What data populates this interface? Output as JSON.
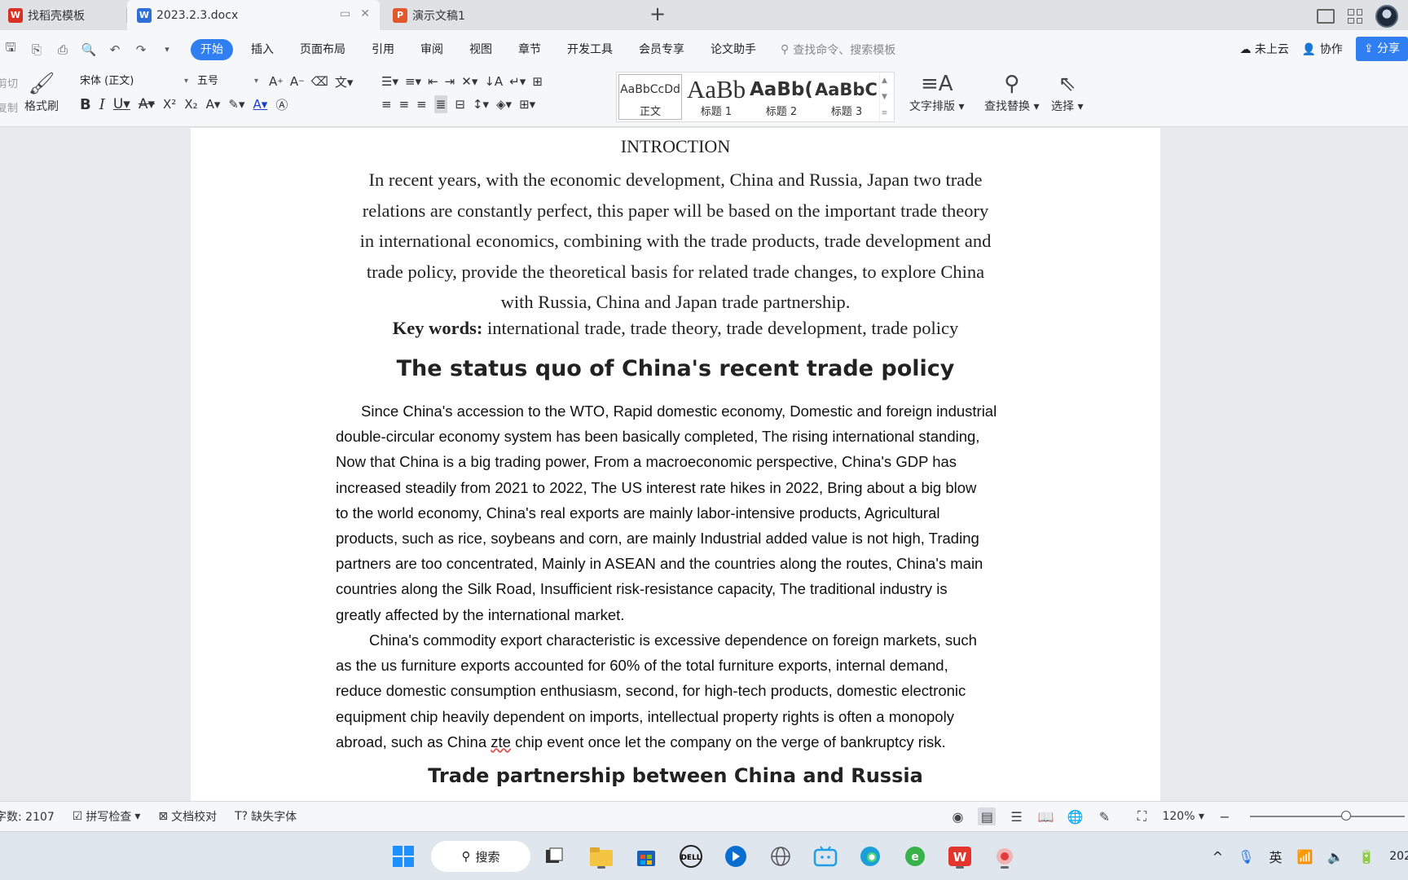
{
  "tabs": [
    {
      "label": "找稻壳模板",
      "icon": "wps-red-icon",
      "color": "#d93025"
    },
    {
      "label": "2023.2.3.docx",
      "icon": "wps-writer-icon",
      "color": "#2f6fd6"
    },
    {
      "label": "演示文稿1",
      "icon": "wps-presentation-icon",
      "color": "#e2572b"
    }
  ],
  "menu": {
    "items": [
      "开始",
      "插入",
      "页面布局",
      "引用",
      "审阅",
      "视图",
      "章节",
      "开发工具",
      "会员专享",
      "论文助手"
    ],
    "search_placeholder": "查找命令、搜索模板",
    "not_synced": "未上云",
    "collaborate": "协作",
    "share": "分享"
  },
  "ribbon": {
    "cut": "剪切",
    "copy": "复制",
    "format_painter": "格式刷",
    "font_name": "宋体 (正文)",
    "font_size": "五号",
    "styles": [
      {
        "preview": "AaBbCcDd",
        "label": "正文"
      },
      {
        "preview": "AaBb",
        "label": "标题 1"
      },
      {
        "preview": "AaBb(",
        "label": "标题 2"
      },
      {
        "preview": "AaBbC",
        "label": "标题 3"
      }
    ],
    "text_layout": "文字排版",
    "find_replace": "查找替换",
    "select": "选择"
  },
  "document": {
    "intro_title": "INTROCTION",
    "abstract_lines": [
      "In recent years, with the economic development, China and Russia, Japan two trade",
      "relations are constantly perfect, this paper will be based on the important trade theory",
      "in international economics, combining with the trade products, trade development and",
      "trade policy, provide the theoretical basis for related trade changes, to explore China",
      "with Russia, China and Japan trade partnership."
    ],
    "keywords_label": "Key words:",
    "keywords_text": " international trade, trade theory, trade development, trade policy",
    "heading1": "The status quo of China's recent trade policy",
    "para1_lines": [
      "Since China's accession to the WTO, Rapid domestic economy, Domestic and foreign industrial",
      "double-circular economy system has been basically completed, The rising international standing,",
      "Now that China is a big trading power, From a macroeconomic perspective, China's GDP has",
      "increased steadily from 2021 to 2022, The US interest rate hikes in 2022, Bring about a big blow",
      "to the world economy, China's real exports are mainly labor-intensive products, Agricultural",
      "products, such as rice, soybeans and corn, are mainly Industrial added value is not high, Trading",
      "partners are too concentrated, Mainly in ASEAN and the countries along the routes, China's main",
      "countries along the Silk Road, Insufficient risk-resistance capacity, The traditional industry is",
      "greatly affected by the international market."
    ],
    "para2_lines": [
      "China's commodity export characteristic is excessive dependence on foreign markets, such",
      "as the us furniture exports accounted for 60% of the total furniture exports, internal demand,",
      "reduce domestic consumption enthusiasm, second, for high-tech products, domestic electronic",
      "equipment chip heavily dependent on imports, intellectual property rights is often a monopoly"
    ],
    "para2_last_before": "abroad, such as China ",
    "para2_last_flagged": "zte",
    "para2_last_after": " chip event once let the company on the verge of bankruptcy risk.",
    "heading2": "Trade partnership between China and Russia"
  },
  "status": {
    "word_count": "字数: 2107",
    "spell_check": "拼写检查",
    "doc_proof": "文档校对",
    "missing_fonts": "缺失字体",
    "zoom": "120%",
    "zoom_fraction": 0.62
  },
  "taskbar": {
    "search": "搜索",
    "ime": "英",
    "clock_partial": "202"
  },
  "colors": {
    "accent": "#2f7ff2",
    "wps_red": "#d93025"
  }
}
